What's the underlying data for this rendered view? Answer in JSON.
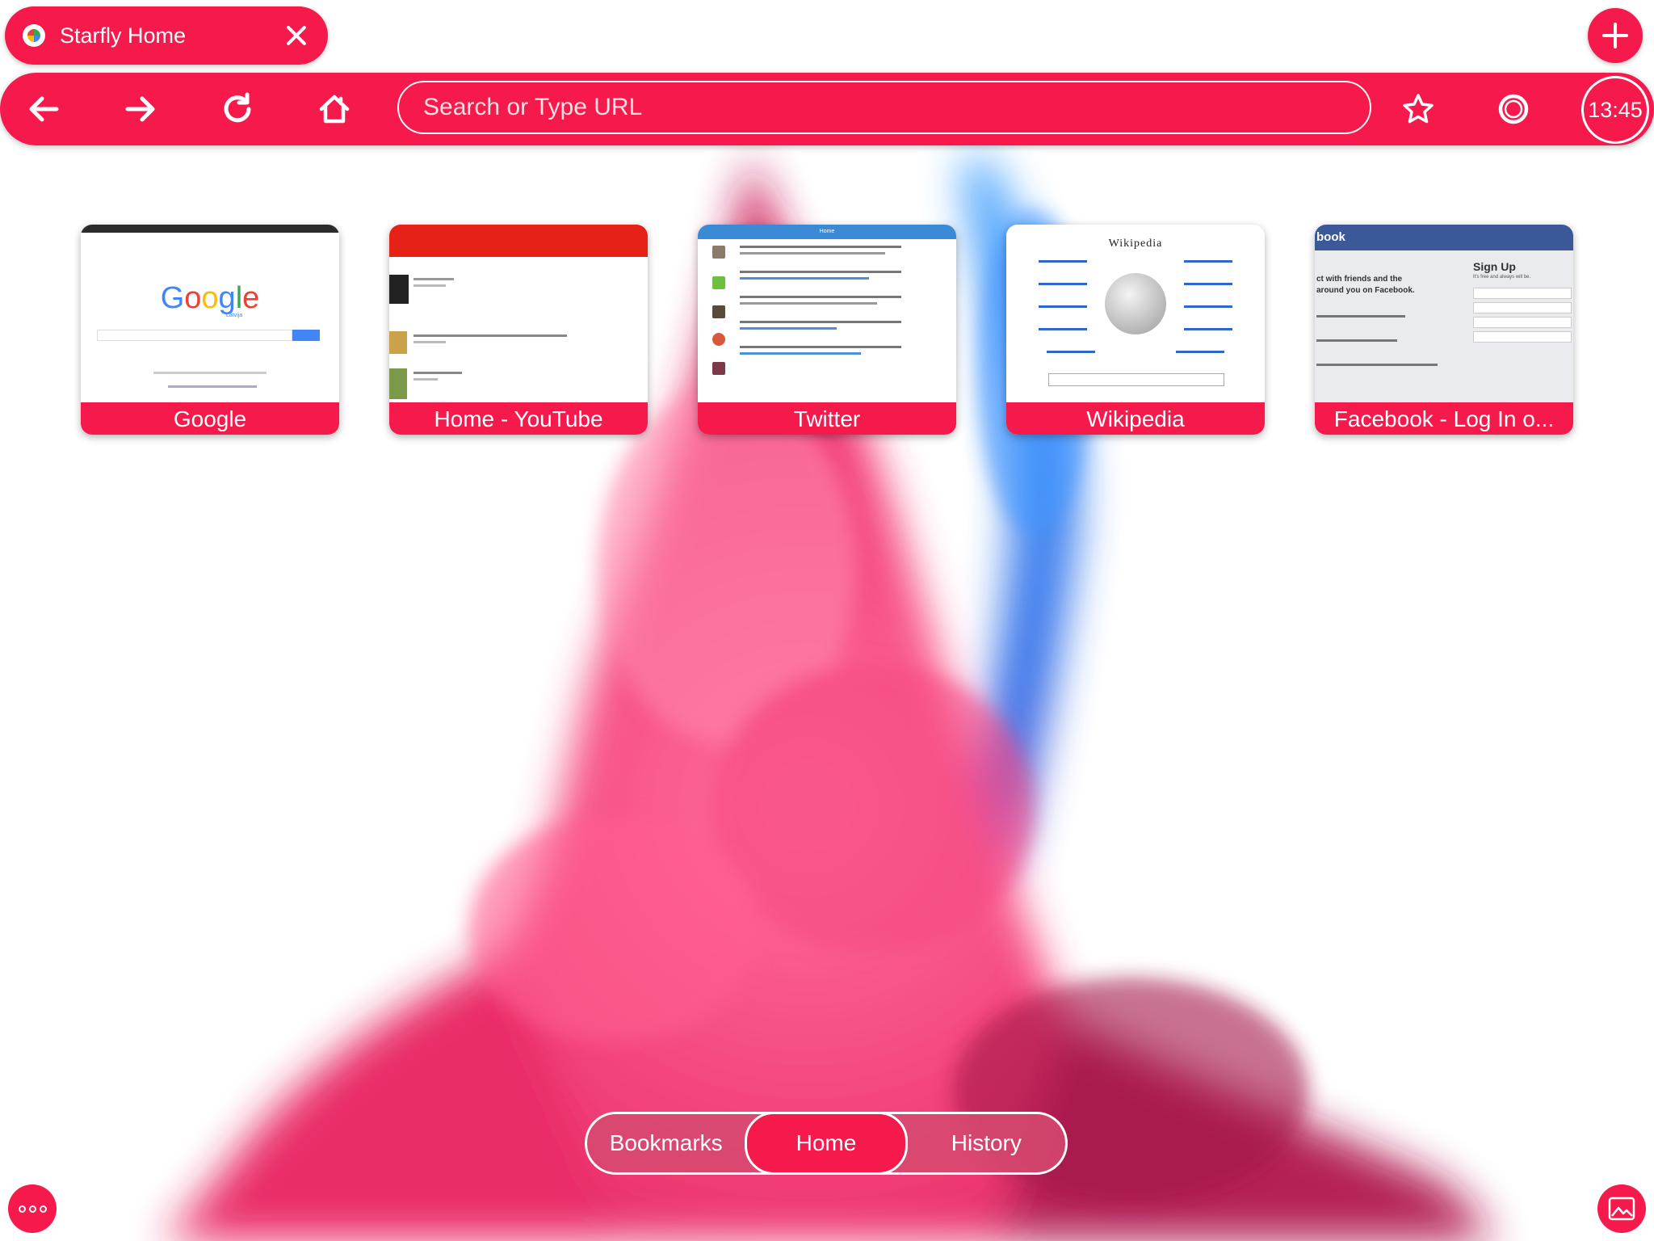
{
  "tab": {
    "title": "Starfly Home"
  },
  "toolbar": {
    "search_placeholder": "Search or Type URL",
    "clock": "13:45"
  },
  "speed_dial": [
    {
      "label": "Google",
      "icon": "google-thumbnail"
    },
    {
      "label": "Home - YouTube",
      "icon": "youtube-thumbnail"
    },
    {
      "label": "Twitter",
      "icon": "twitter-thumbnail"
    },
    {
      "label": "Wikipedia",
      "icon": "wikipedia-thumbnail"
    },
    {
      "label": "Facebook - Log In o...",
      "icon": "facebook-thumbnail"
    }
  ],
  "thumbs": {
    "google": {
      "logo": "Google",
      "sub": "Latvija"
    },
    "wikipedia": {
      "logo": "Wikipedia"
    },
    "facebook": {
      "brand": "book",
      "signup": "Sign Up",
      "tagline": "It's free and always will be.",
      "connect": "ct with friends and the",
      "around": "around you on Facebook."
    },
    "twitter": {
      "header": "Home"
    }
  },
  "nav": {
    "bookmarks": "Bookmarks",
    "home": "Home",
    "history": "History",
    "active": "Home"
  },
  "colors": {
    "accent": "#f5194c",
    "nav_inactive": "#d64a70"
  }
}
